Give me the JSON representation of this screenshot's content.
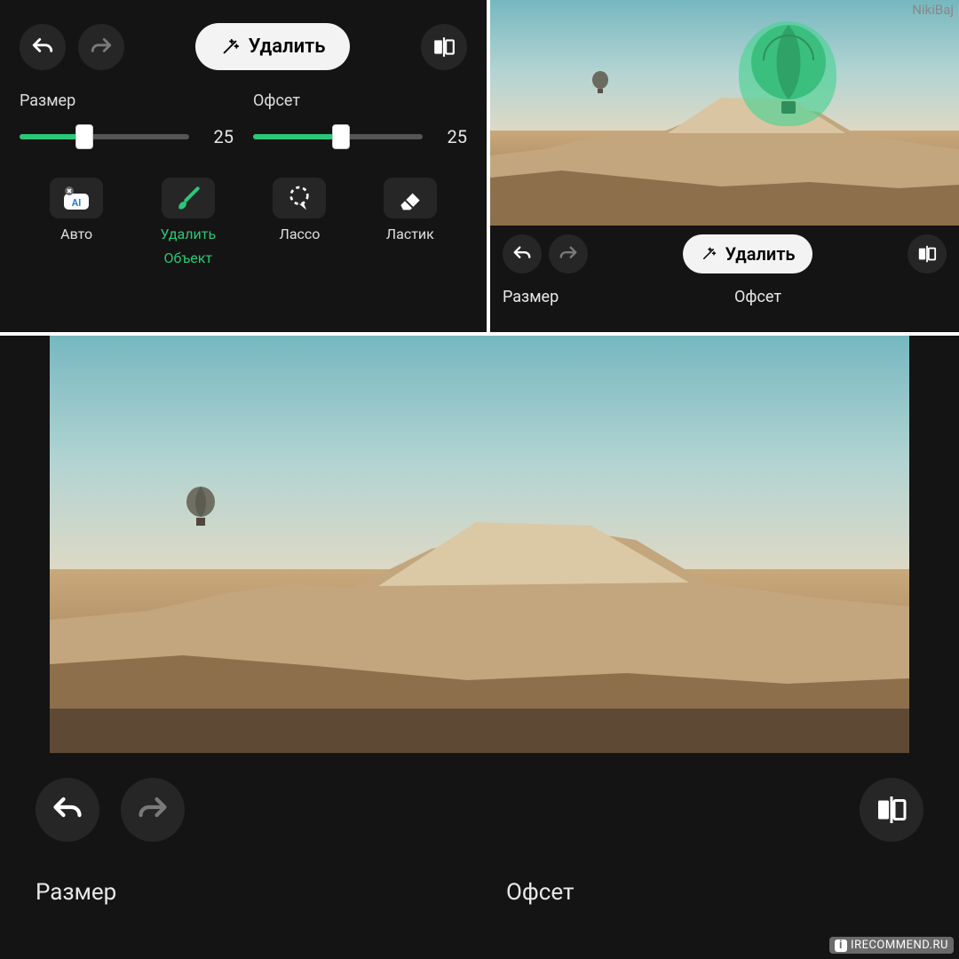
{
  "watermark_top": "NikiBaj",
  "watermark_bottom": "IRECOMMEND.RU",
  "remove_button": "Удалить",
  "slider": {
    "size_label": "Размер",
    "size_value": "25",
    "size_pct": 38,
    "offset_label": "Офсет",
    "offset_value": "25",
    "offset_pct": 52
  },
  "tools": {
    "auto": "Авто",
    "remove_line1": "Удалить",
    "remove_line2": "Объект",
    "lasso": "Лассо",
    "eraser": "Ластик"
  },
  "colors": {
    "accent": "#2bc777",
    "bg": "#141414",
    "chip": "#262626"
  }
}
